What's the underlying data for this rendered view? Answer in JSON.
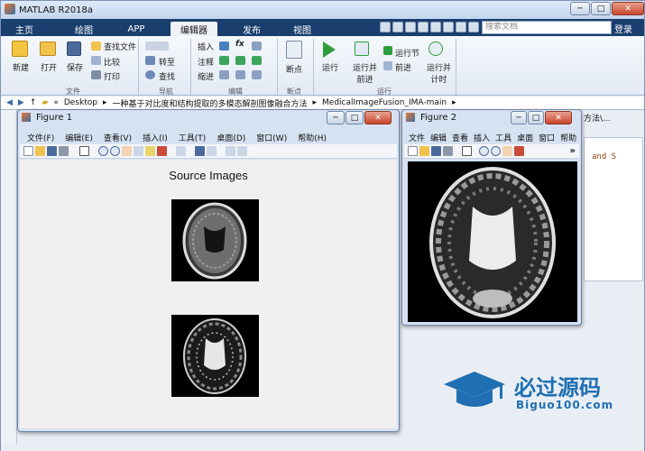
{
  "app": {
    "title": "MATLAB R2018a",
    "min": "─",
    "max": "□",
    "close": "✕"
  },
  "tabs": [
    "主页",
    "绘图",
    "APP",
    "编辑器",
    "发布",
    "视图"
  ],
  "search": {
    "placeholder": "搜索文档"
  },
  "login": "登录",
  "ribbon": {
    "new": "新建",
    "open": "打开",
    "save": "保存",
    "find_files": "查找文件",
    "compare": "比较",
    "print": "打印",
    "goto": "转至",
    "find": "查找",
    "insert": "插入",
    "comment": "注释",
    "indent": "缩进",
    "fx": "fx",
    "breakpoints": "断点",
    "run": "运行",
    "run_advance": "运行并\n前进",
    "run_section": "运行节",
    "advance": "前进",
    "run_time": "运行并\n计时",
    "groups": {
      "file": "文件",
      "nav": "导航",
      "edit": "编辑",
      "bp": "断点",
      "run": "运行"
    }
  },
  "address": {
    "arrow": "«",
    "parts": [
      "Desktop",
      "一种基于对比度和结构提取的多模态解剖图像融合方法",
      "MedicalImageFusion_IMA-main"
    ]
  },
  "figure1": {
    "title": "Figure 1",
    "menu": [
      "文件(F)",
      "编辑(E)",
      "查看(V)",
      "插入(I)",
      "工具(T)",
      "桌面(D)",
      "窗口(W)",
      "帮助(H)"
    ],
    "axes_title": "Source Images"
  },
  "figure2": {
    "title": "Figure 2",
    "menu": [
      "文件",
      "编辑",
      "查看",
      "插入",
      "工具",
      "桌面",
      "窗口",
      "帮助"
    ],
    "more": "»"
  },
  "background": {
    "code_fragment": "and S",
    "path_fragment": "方法\\..."
  },
  "watermark": {
    "name": "必过源码",
    "url": "Biguo100.com"
  },
  "colors": {
    "tabbar": "#1a3e6e",
    "ribbon": "#eef2f7",
    "watermark": "#1f6fb2"
  }
}
